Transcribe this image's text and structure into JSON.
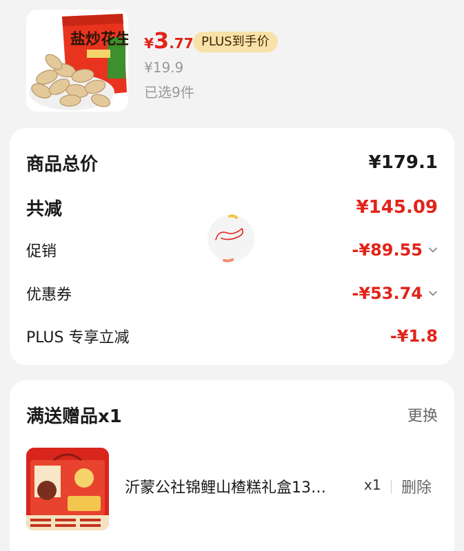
{
  "product": {
    "image_icon": "peanut-snack-bag-image",
    "bag_text": "盐炒花生",
    "price_symbol": "¥",
    "price_int": "3",
    "price_dec": ".77",
    "plus_badge": "PLUS到手价",
    "original_price": "¥19.9",
    "selected": "已选9件"
  },
  "summary": {
    "total_label": "商品总价",
    "total_value": "¥179.1",
    "discount_label": "共减",
    "discount_value": "¥145.09",
    "promo_label": "促销",
    "promo_value": "-¥89.55",
    "coupon_label": "优惠券",
    "coupon_value": "-¥53.74",
    "plus_label": "PLUS 专享立减",
    "plus_value": "-¥1.8"
  },
  "gift": {
    "title": "满送赠品x1",
    "swap_label": "更换",
    "image_icon": "hawthorn-cake-gift-box-image",
    "name": "沂蒙公社锦鲤山楂糕礼盒13…",
    "qty": "x1",
    "delete_label": "删除"
  },
  "colors": {
    "accent_red": "#e2231a",
    "plus_badge_bg": "#f9e2a8",
    "page_bg": "#f3f3f3"
  }
}
